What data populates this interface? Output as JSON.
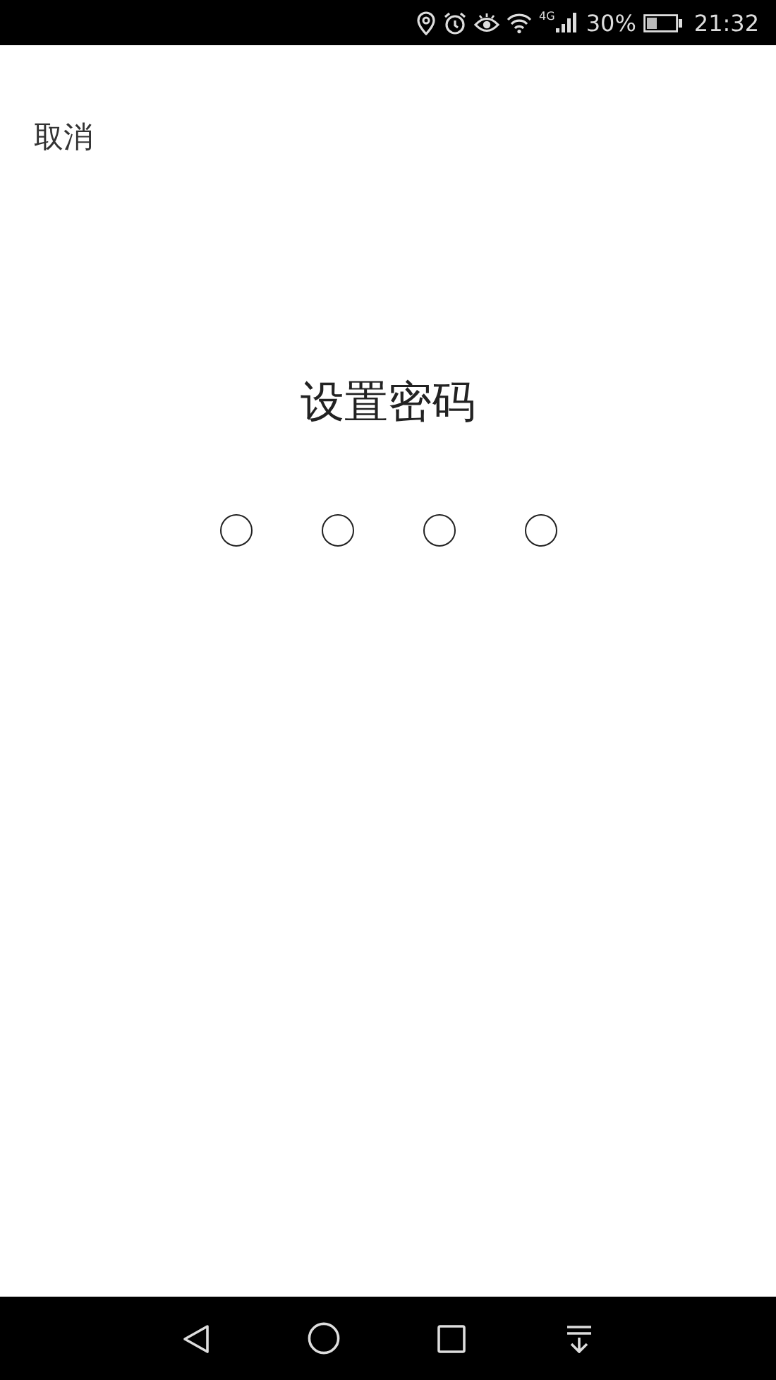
{
  "status_bar": {
    "network": "4G",
    "battery": "30%",
    "time": "21:32"
  },
  "cancel": "取消",
  "title": "设置密码",
  "pin_dots": [
    {
      "filled": false
    },
    {
      "filled": false
    },
    {
      "filled": false
    },
    {
      "filled": false
    }
  ]
}
